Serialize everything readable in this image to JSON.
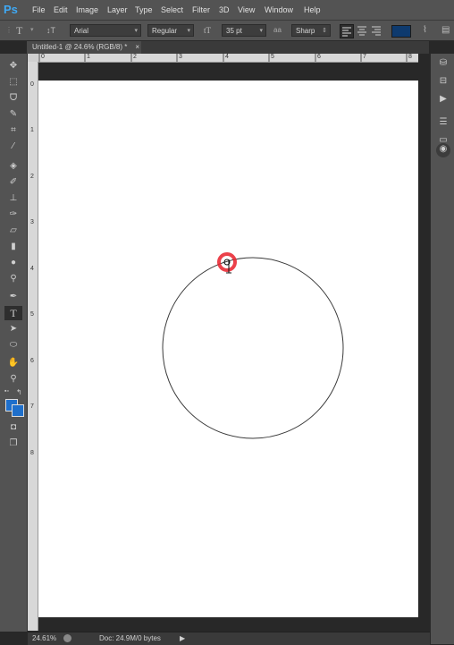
{
  "menu": {
    "logo": "Ps",
    "items": [
      "File",
      "Edit",
      "Image",
      "Layer",
      "Type",
      "Select",
      "Filter",
      "3D",
      "View",
      "Window",
      "Help"
    ]
  },
  "options": {
    "tool_glyph": "T",
    "orient_glyph": "↕T",
    "font_family": "Arial",
    "font_style": "Regular",
    "size_glyph": "tT",
    "font_size": "35 pt",
    "aa_glyph": "aa",
    "antialias": "Sharp",
    "text_color": "#0e3a6e"
  },
  "document": {
    "tab_title": "Untitled-1 @ 24.6% (RGB/8) *",
    "tab_close": "×"
  },
  "rulers": {
    "top_labels": [
      "0",
      "1",
      "2",
      "3",
      "4",
      "5",
      "6",
      "7",
      "8"
    ],
    "left_labels": [
      "0",
      "1",
      "2",
      "3",
      "4",
      "5",
      "6",
      "7",
      "8"
    ]
  },
  "status": {
    "zoom": "24.61%",
    "doc": "Doc: 24.9M/0 bytes"
  },
  "colors": {
    "foreground": "#1e6fcb",
    "background": "#1e6fcb",
    "accent_red": "#e8202a"
  }
}
